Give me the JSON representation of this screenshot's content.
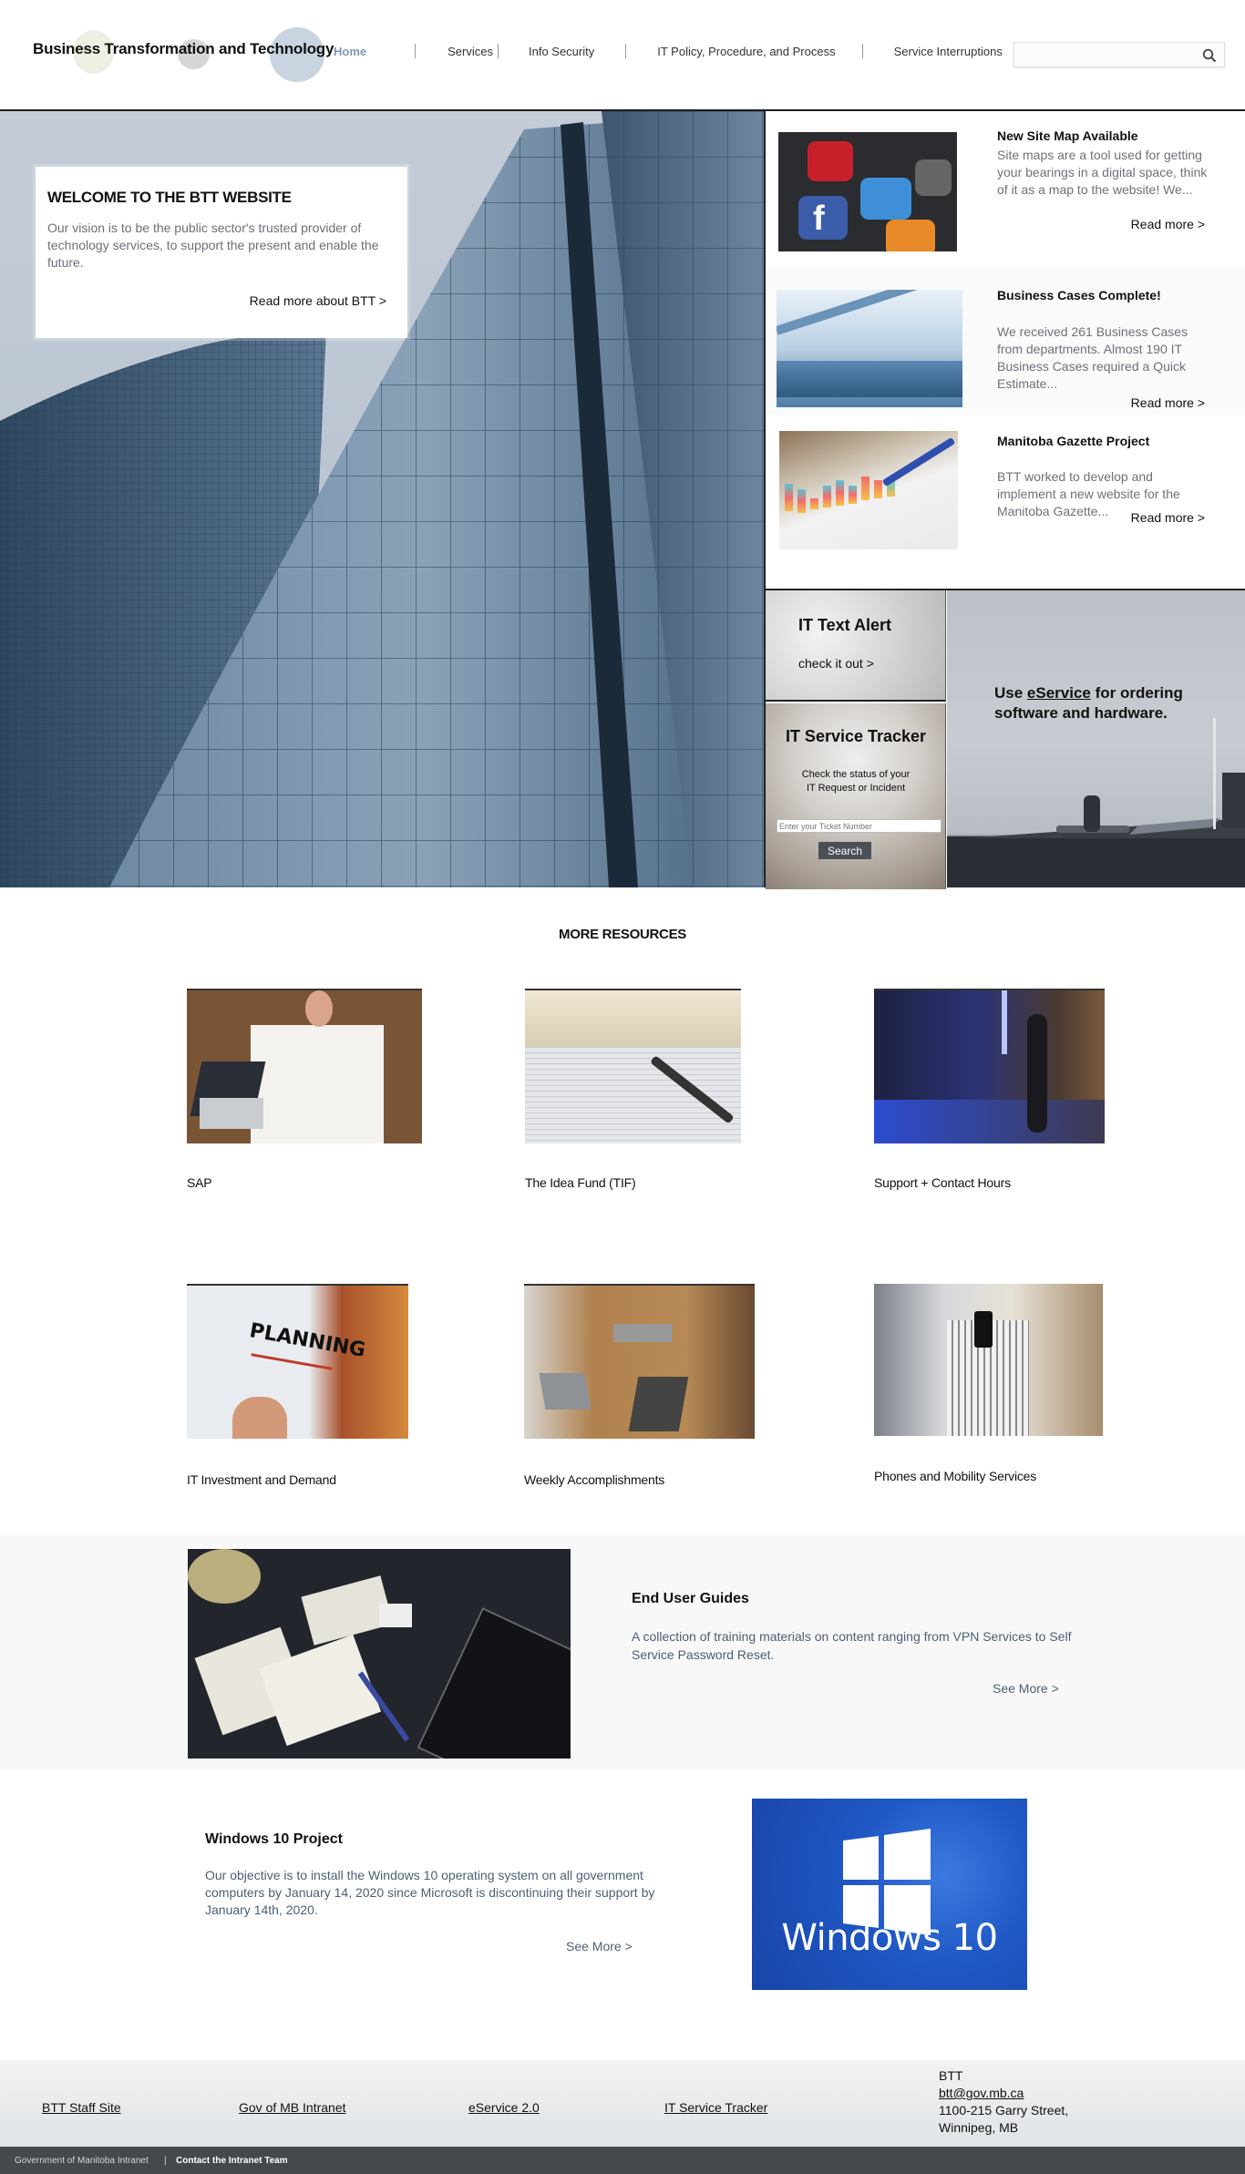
{
  "header": {
    "site_title": "Business Transformation and Technology",
    "nav": [
      {
        "label": "Home",
        "active": true
      },
      {
        "label": "Services",
        "active": false
      },
      {
        "label": "Info Security",
        "active": false
      },
      {
        "label": "IT Policy, Procedure, and Process",
        "active": false
      },
      {
        "label": "Service Interruptions",
        "active": false
      }
    ],
    "search": {
      "placeholder": "",
      "value": "",
      "icon": "search-icon"
    }
  },
  "hero": {
    "title": "WELCOME TO THE BTT WEBSITE",
    "text": "Our vision is to be the public sector's trusted provider of technology services, to support the present and enable the future.",
    "link": "Read more about BTT >"
  },
  "news": [
    {
      "title": "New Site Map Available",
      "text": "Site maps are a tool used for getting your bearings in a digital space, think of it as a map to the website! We...",
      "link": "Read more >",
      "image": "smartphone app icons (Facebook, Twitter, Vine)"
    },
    {
      "title": "Business Cases Complete!",
      "text": "We received 261 Business Cases from departments. Almost 190 IT Business Cases required a Quick Estimate...",
      "link": "Read more >",
      "image": "laptop opening in blue light"
    },
    {
      "title": "Manitoba Gazette Project",
      "text": "BTT worked to develop and implement a new website for the Manitoba Gazette...",
      "link": "Read more >",
      "image": "pen pointing at bar chart on paper"
    }
  ],
  "tiles": {
    "alert": {
      "title": "IT Text Alert",
      "link": "check it out >"
    },
    "tracker": {
      "title": "IT Service Tracker",
      "text_line1": "Check the status of your",
      "text_line2": "IT Request or Incident",
      "input_placeholder": "Enter your Ticket Number",
      "button": "Search"
    },
    "eservice": {
      "prefix": "Use ",
      "link": "eService",
      "suffix": " for ordering software and hardware."
    }
  },
  "resources": {
    "title": "MORE RESOURCES",
    "items": [
      {
        "label": "SAP",
        "image": "team planning on desk with laptop"
      },
      {
        "label": "The Idea Fund (TIF)",
        "image": "open book, notepad and pen"
      },
      {
        "label": "Support + Contact Hours",
        "image": "woman in server room with tablet"
      },
      {
        "label": "IT Investment and Demand",
        "image": "planning notebook"
      },
      {
        "label": "Weekly Accomplishments",
        "image": "team meeting with laptops"
      },
      {
        "label": "Phones and Mobility Services",
        "image": "people using smartphones"
      }
    ]
  },
  "guides": {
    "title": "End User Guides",
    "text": "A collection of training materials on content ranging from VPN Services to Self Service Password Reset.",
    "link": "See More >",
    "image": "wireframe sketches, pencils and phone on desk"
  },
  "windows": {
    "title": "Windows 10 Project",
    "text": "Our objective is to install the Windows 10 operating system on all government computers by January 14, 2020 since Microsoft is discontinuing their support by January 14th, 2020.",
    "link": "See More >",
    "image_text": "Windows 10"
  },
  "footer": {
    "links": [
      "BTT Staff Site",
      "Gov of MB Intranet",
      "eService 2.0",
      "IT Service Tracker"
    ],
    "contact": {
      "name": "BTT",
      "email": "btt@gov.mb.ca",
      "address1": "1100-215 Garry Street,",
      "address2": "Winnipeg, MB"
    },
    "bottom": {
      "left": "Government of Manitoba Intranet",
      "divider": "|",
      "right": "Contact the Intranet Team"
    }
  },
  "colors": {
    "nav_active": "#7f99b5",
    "body_text_blue": "#4d5e73",
    "bottom_bar": "#45484c",
    "search_button": "#4a5056"
  }
}
